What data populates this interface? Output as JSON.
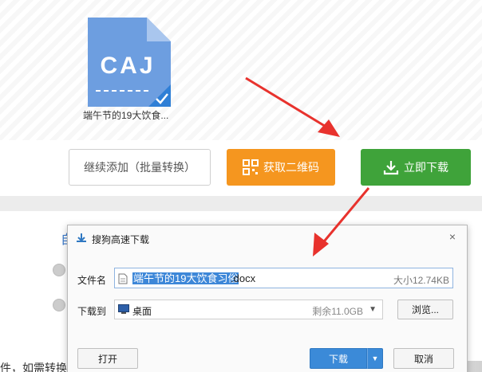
{
  "file": {
    "icon_text": "CAJ",
    "name": "端午节的19大饮食...",
    "icon": "caj-file-icon",
    "checked": true
  },
  "actions": {
    "add_label": "继续添加（批量转换）",
    "qr_label": "获取二维码",
    "download_label": "立即下载",
    "qr_icon": "qr-code-icon",
    "download_icon": "download-icon"
  },
  "background": {
    "peek_text": "自",
    "bottom_text": "件，如需转换"
  },
  "dialog": {
    "title": "搜狗高速下载",
    "close": "×",
    "filename_label": "文件名",
    "filename_selected": "端午节的19大饮食习俗",
    "filename_ext": ".docx",
    "filesize": "大小12.74KB",
    "dest_label": "下载到",
    "dest_name": "桌面",
    "dest_free": "剩余11.0GB",
    "browse_label": "浏览...",
    "open_label": "打开",
    "download_label": "下载",
    "cancel_label": "取消"
  },
  "colors": {
    "orange": "#f5961f",
    "green": "#3fa33a",
    "blue": "#3b8ad8",
    "annotation_red": "#e8322d"
  }
}
